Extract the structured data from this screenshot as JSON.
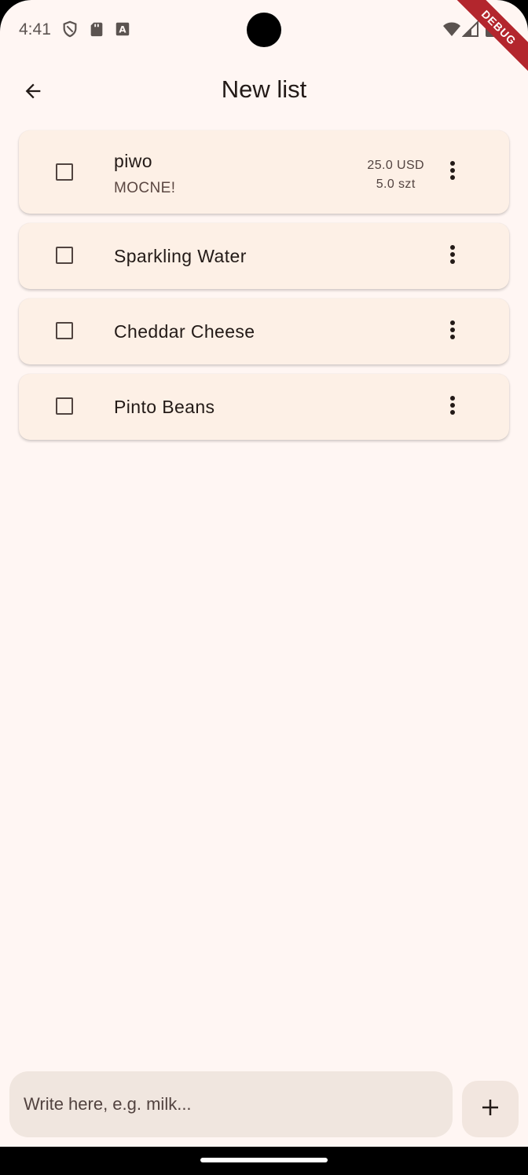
{
  "status_bar": {
    "time": "4:41",
    "icons": [
      "shield-icon",
      "sd-card-icon",
      "keyboard-a-icon",
      "wifi-icon",
      "signal-icon",
      "battery-icon"
    ],
    "debug_banner": "DEBUG"
  },
  "app_bar": {
    "back_icon": "arrow-back-icon",
    "title": "New list"
  },
  "items": [
    {
      "name": "piwo",
      "note": "MOCNE!",
      "price": "25.0 USD",
      "quantity": "5.0 szt",
      "checked": false
    },
    {
      "name": "Sparkling Water",
      "checked": false
    },
    {
      "name": "Cheddar Cheese",
      "checked": false
    },
    {
      "name": "Pinto Beans",
      "checked": false
    }
  ],
  "input": {
    "placeholder": "Write here, e.g. milk...",
    "value": ""
  },
  "add_button_icon": "plus-icon",
  "colors": {
    "background": "#fff6f3",
    "card": "#fdf0e6",
    "input": "#f0e6df",
    "debug": "#b3262d"
  }
}
